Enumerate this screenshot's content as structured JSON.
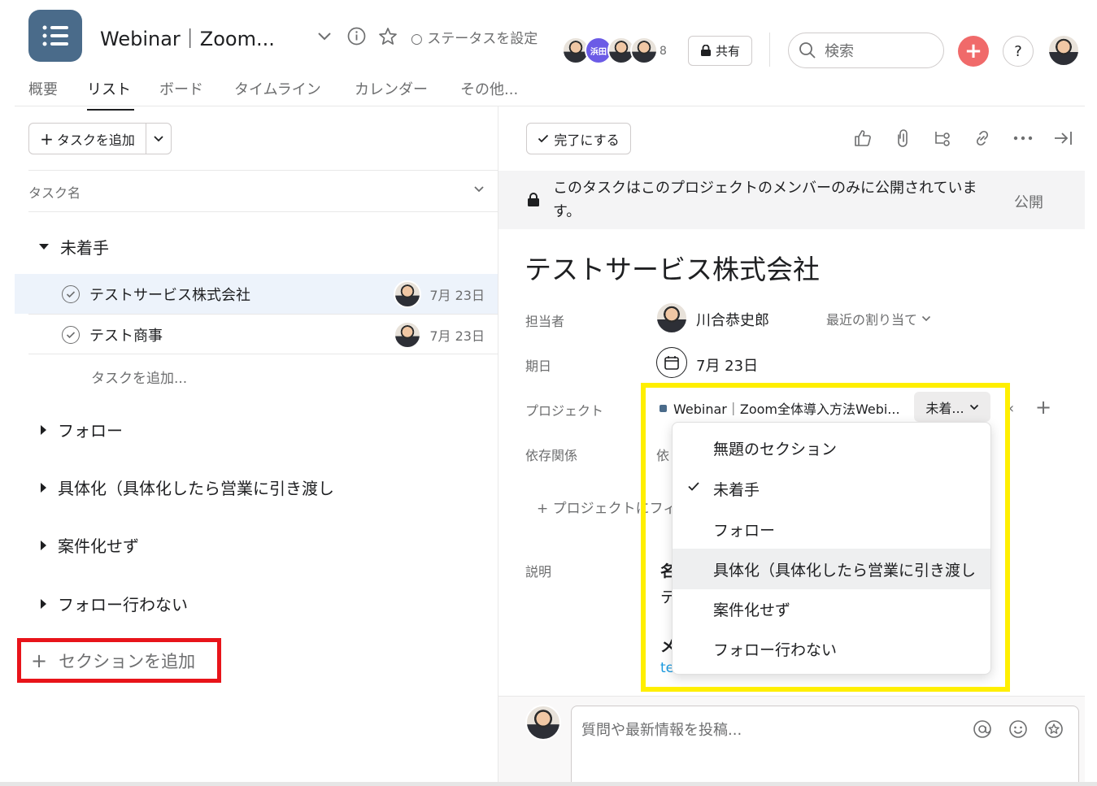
{
  "header": {
    "project_title": "Webinar｜Zoom...",
    "status_label": "○ ステータスを設定",
    "member_count": "8",
    "member_badge_text": "浜田",
    "share_label": "共有",
    "search_placeholder": "検索"
  },
  "tabs": [
    {
      "label": "概要"
    },
    {
      "label": "リスト"
    },
    {
      "label": "ボード"
    },
    {
      "label": "タイムライン"
    },
    {
      "label": "カレンダー"
    },
    {
      "label": "その他..."
    }
  ],
  "list": {
    "add_task_label": "タスクを追加",
    "column_header": "タスク名",
    "sections": [
      {
        "name": "未着手",
        "expanded": true
      },
      {
        "name": "フォロー"
      },
      {
        "name": "具体化（具体化したら営業に引き渡し"
      },
      {
        "name": "案件化せず"
      },
      {
        "name": "フォロー行わない"
      }
    ],
    "tasks": [
      {
        "name": "テストサービス株式会社",
        "due": "7月 23日"
      },
      {
        "name": "テスト商事",
        "due": "7月 23日"
      }
    ],
    "add_task_inline": "タスクを追加...",
    "add_section_label": "セクションを追加"
  },
  "detail": {
    "complete_label": "完了にする",
    "privacy_text": "このタスクはこのプロジェクトのメンバーのみに公開されています。",
    "public_label": "公開",
    "title": "テストサービス株式会社",
    "assignee_label": "担当者",
    "assignee_name": "川合恭史郎",
    "recent_assign_label": "最近の割り当て",
    "due_label": "期日",
    "due_value": "7月 23日",
    "project_label": "プロジェクト",
    "project_name": "Webinar｜Zoom全体導入方法Webi...",
    "section_selected": "未着...",
    "dependency_label": "依存関係",
    "dependency_cut": "依",
    "add_to_project": "+ プロジェクトにフィ",
    "description_label": "説明",
    "desc_cut_1": "名",
    "desc_cut_2": "テ",
    "desc_cut_3": "メ",
    "desc_link_cut": "te"
  },
  "dropdown": {
    "items": [
      {
        "label": "無題のセクション"
      },
      {
        "label": "未着手",
        "checked": true
      },
      {
        "label": "フォロー"
      },
      {
        "label": "具体化（具体化したら営業に引き渡し",
        "hover": true
      },
      {
        "label": "案件化せず"
      },
      {
        "label": "フォロー行わない"
      }
    ]
  },
  "comment": {
    "placeholder": "質問や最新情報を投稿..."
  },
  "colors": {
    "highlight_red": "#e8141a",
    "highlight_yellow": "#ffef00",
    "accent_plus": "#f06a6a",
    "project_icon": "#4a6b8a"
  }
}
